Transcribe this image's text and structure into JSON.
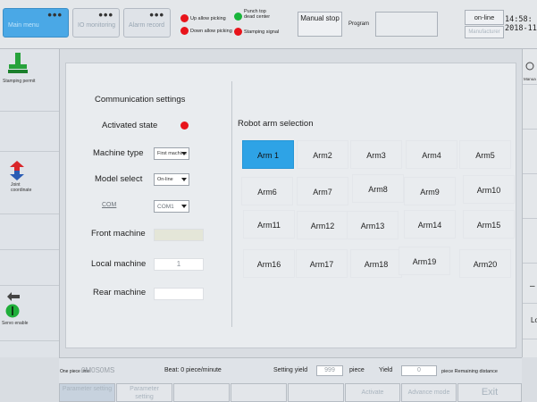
{
  "top": {
    "tabs": [
      {
        "label": "Main menu",
        "active": true
      },
      {
        "label": "IO monitoring",
        "active": false
      },
      {
        "label": "Alarm record",
        "active": false
      }
    ],
    "signals": {
      "up_allow_picking": "Up allow picking",
      "down_allow_picking": "Down allow picking",
      "punch_top_dead_center": "Punch top dead center",
      "stamping_signal": "Stamping signal"
    },
    "manual_stop": "Manual stop",
    "program_label": "Program",
    "online_button": "on-line",
    "manufacturer_button": "Manufacturer",
    "clock_time": "14:58:",
    "clock_date": "2018-11"
  },
  "left": {
    "stamping_label": "Stamping permit",
    "joint_label": "Joint coordinate",
    "servo_label": "Servo enable"
  },
  "right": {
    "top_label": "Manua",
    "bottom_label": "Lo"
  },
  "comm": {
    "title": "Communication settings",
    "activated_state": "Activated state",
    "machine_type_label": "Machine type",
    "machine_type_value": "First machine",
    "model_select_label": "Model select",
    "model_select_value": "On-line",
    "com_label": "COM",
    "com_value": "COM1",
    "front_machine_label": "Front machine",
    "local_machine_label": "Local machine",
    "local_machine_value": "1",
    "rear_machine_label": "Rear machine"
  },
  "robot": {
    "title": "Robot arm selection",
    "arms": [
      [
        "Arm 1",
        "Arm2",
        "Arm3",
        "Arm4",
        "Arm5"
      ],
      [
        "Arm6",
        "Arm7",
        "Arm8",
        "Arm9",
        "Arm10"
      ],
      [
        "Arm11",
        "Arm12",
        "Arm13",
        "Arm14",
        "Arm15"
      ],
      [
        "Arm16",
        "Arm17",
        "Arm18",
        "Arm19",
        "Arm20"
      ]
    ],
    "selected": "Arm 1"
  },
  "bottom": {
    "one_piece_time_label": "One piece time",
    "one_piece_time_value": "0M0S0MS",
    "beat": "Beat: 0 piece/minute",
    "setting_yield_label": "Setting yield",
    "setting_yield_value": "999",
    "piece": "piece",
    "yield_label": "Yield",
    "yield_value": "0",
    "remaining_label": "piece  Remaining distance",
    "buttons": [
      "Parameter setting",
      "Parameter setting",
      "",
      "",
      "",
      "Activate",
      "Advance mode",
      "Exit"
    ]
  },
  "colors": {
    "accent_blue": "#2ea3e6",
    "alarm_red": "#e8141b",
    "ok_green": "#18b43a"
  }
}
